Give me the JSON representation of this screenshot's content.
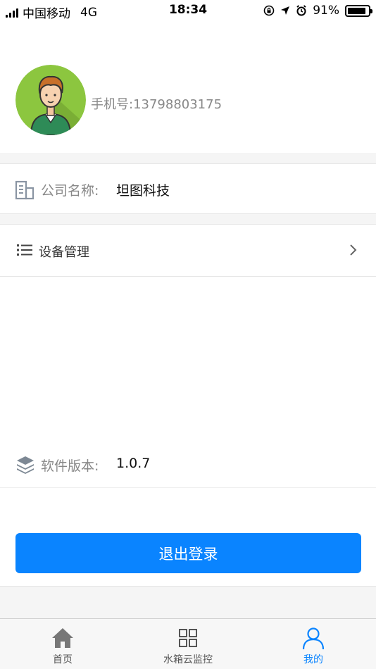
{
  "status_bar": {
    "carrier": "中国移动",
    "network": "4G",
    "time": "18:34",
    "battery": "91%",
    "battery_level": 0.91
  },
  "profile": {
    "phone_text": "手机号:13798803175"
  },
  "company": {
    "label": "公司名称:",
    "value": "坦图科技"
  },
  "menu": {
    "device_management": "设备管理"
  },
  "version": {
    "label": "软件版本:",
    "value": "1.0.7"
  },
  "logout": {
    "label": "退出登录"
  },
  "tabs": [
    {
      "label": "首页",
      "icon": "home-icon"
    },
    {
      "label": "水箱云监控",
      "icon": "grid-icon"
    },
    {
      "label": "我的",
      "icon": "user-icon",
      "active": true
    }
  ],
  "colors": {
    "accent": "#0a84ff",
    "avatar_bg": "#8cc63f"
  }
}
